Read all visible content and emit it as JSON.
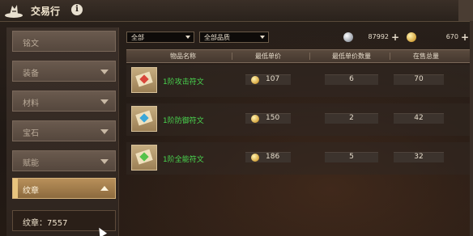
{
  "window": {
    "title": "交易行",
    "info_icon": "i"
  },
  "sidebar": {
    "items": [
      {
        "label": "铭文",
        "expanded": false,
        "has_chevron": false
      },
      {
        "label": "装备",
        "expanded": false,
        "has_chevron": true
      },
      {
        "label": "材料",
        "expanded": false,
        "has_chevron": true
      },
      {
        "label": "宝石",
        "expanded": false,
        "has_chevron": true
      },
      {
        "label": "赋能",
        "expanded": false,
        "has_chevron": true
      },
      {
        "label": "纹章",
        "expanded": true,
        "has_chevron": true
      }
    ],
    "subitem": {
      "label": "纹章：7557"
    }
  },
  "filters": {
    "category": {
      "selected": "全部"
    },
    "quality": {
      "selected": "全部品质"
    }
  },
  "currency": {
    "silver": {
      "amount": "87992",
      "icon": "silver-coin-icon"
    },
    "gold": {
      "amount": "670",
      "icon": "gold-coin-icon"
    },
    "add_symbol": "+"
  },
  "table": {
    "headers": [
      "物品名称",
      "最低单价",
      "最低单价数量",
      "在售总量"
    ],
    "rows": [
      {
        "name": "1阶攻击符文",
        "price": "107",
        "qty": "6",
        "stock": "70",
        "gem_color": "#d9463a"
      },
      {
        "name": "1阶防御符文",
        "price": "150",
        "qty": "2",
        "stock": "42",
        "gem_color": "#3aa7d9"
      },
      {
        "name": "1阶全能符文",
        "price": "186",
        "qty": "5",
        "stock": "32",
        "gem_color": "#54c24a"
      }
    ]
  },
  "colors": {
    "accent": "#b8905a",
    "item_name": "#49d64f",
    "text": "#e6dccb"
  }
}
